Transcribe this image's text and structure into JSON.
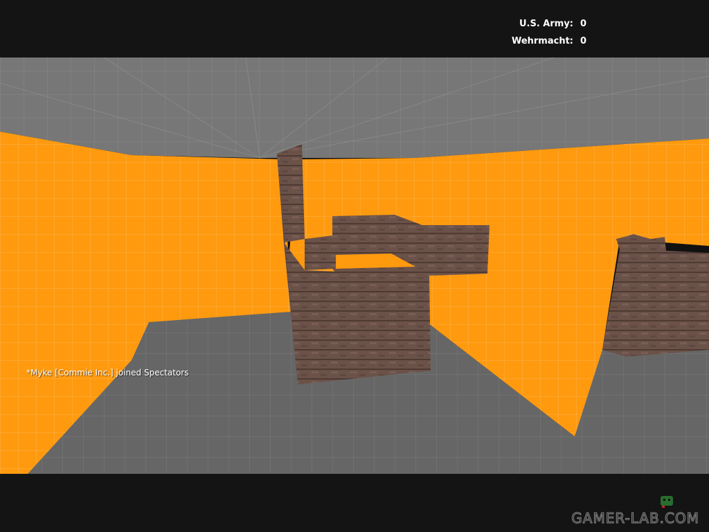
{
  "hud": {
    "scoreboard": [
      {
        "team": "U.S. Army:",
        "score": "0"
      },
      {
        "team": "Wehrmacht:",
        "score": "0"
      }
    ]
  },
  "chat": {
    "message": "*Myke [Commie Inc.] joined Spectators"
  },
  "watermark": {
    "text": "GAMER-LAB.COM"
  },
  "colors": {
    "wall_orange": "#ff9a0f",
    "floor_gray": "#666666",
    "ceiling_gray": "#7a7a7a",
    "brick": "#6b5249",
    "letterbox": "#141414"
  }
}
